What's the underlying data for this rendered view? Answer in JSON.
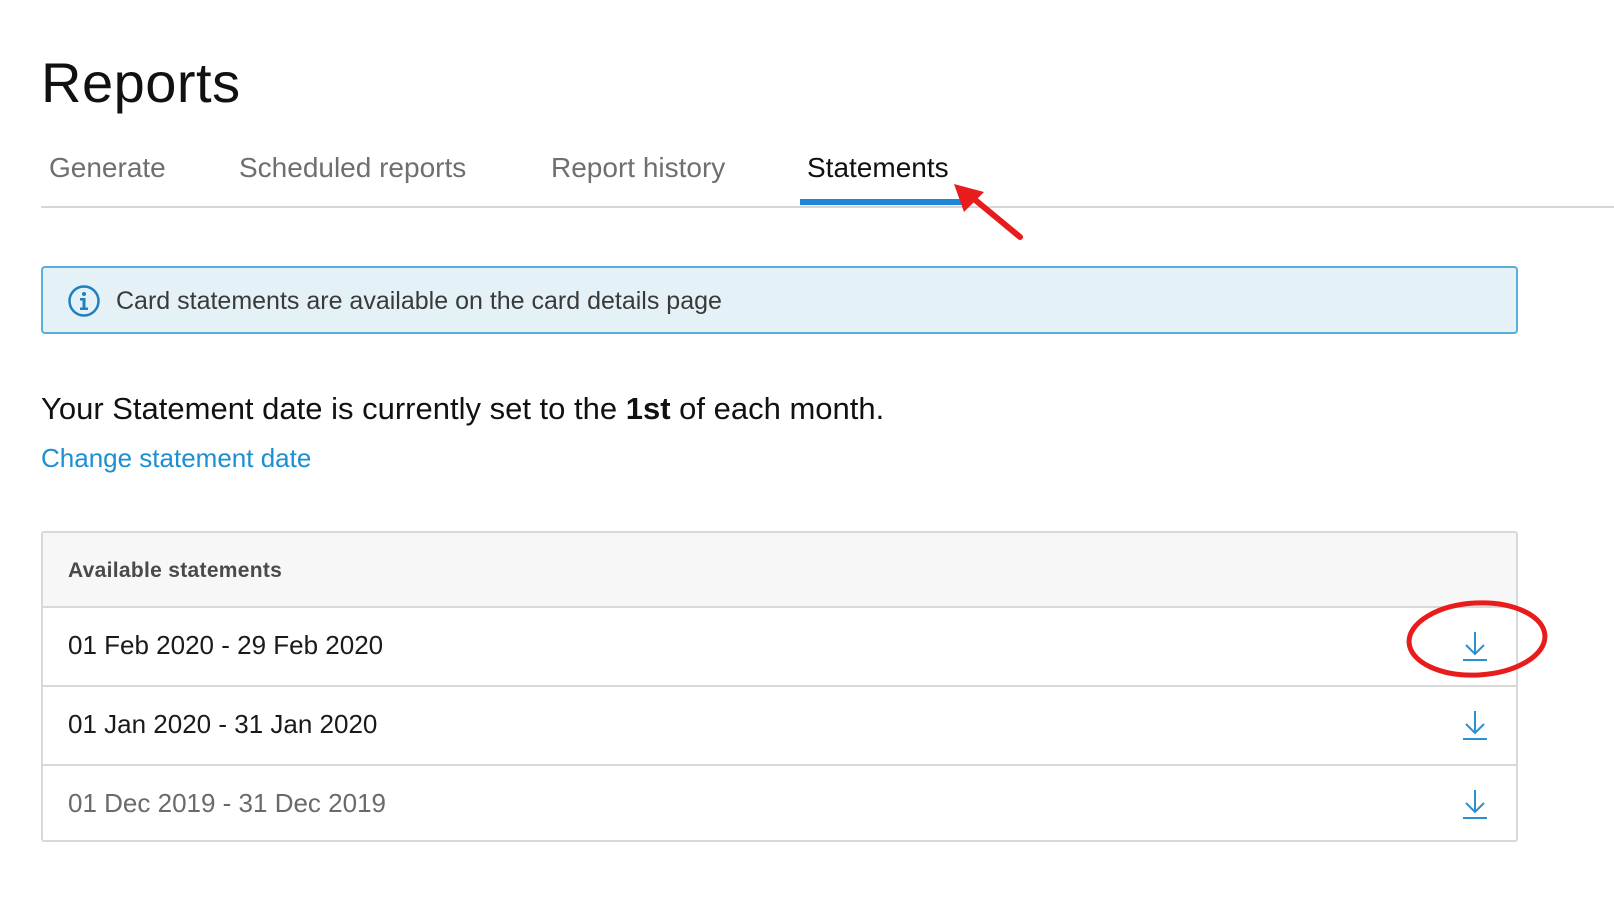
{
  "page": {
    "title": "Reports"
  },
  "tabs": [
    {
      "label": "Generate",
      "active": false
    },
    {
      "label": "Scheduled reports",
      "active": false
    },
    {
      "label": "Report history",
      "active": false
    },
    {
      "label": "Statements",
      "active": true
    }
  ],
  "info_banner": {
    "icon": "info-icon",
    "text": "Card statements are available on the card details page"
  },
  "statement_settings": {
    "prefix": "Your Statement date is currently set to the ",
    "day": "1st",
    "suffix": " of each month.",
    "change_link": "Change statement date"
  },
  "statements_table": {
    "header": "Available statements",
    "rows": [
      {
        "period": "01 Feb 2020 - 29 Feb 2020",
        "action_icon": "download-icon"
      },
      {
        "period": "01 Jan 2020 - 31 Jan 2020",
        "action_icon": "download-icon"
      },
      {
        "period": "01 Dec 2019 - 31 Dec 2019",
        "action_icon": "download-icon"
      }
    ]
  },
  "colors": {
    "accent": "#1e88d6",
    "link": "#1b8fd2",
    "banner_bg": "#e4f2f8",
    "banner_border": "#5aaed8",
    "annotation": "#e81c1c"
  }
}
